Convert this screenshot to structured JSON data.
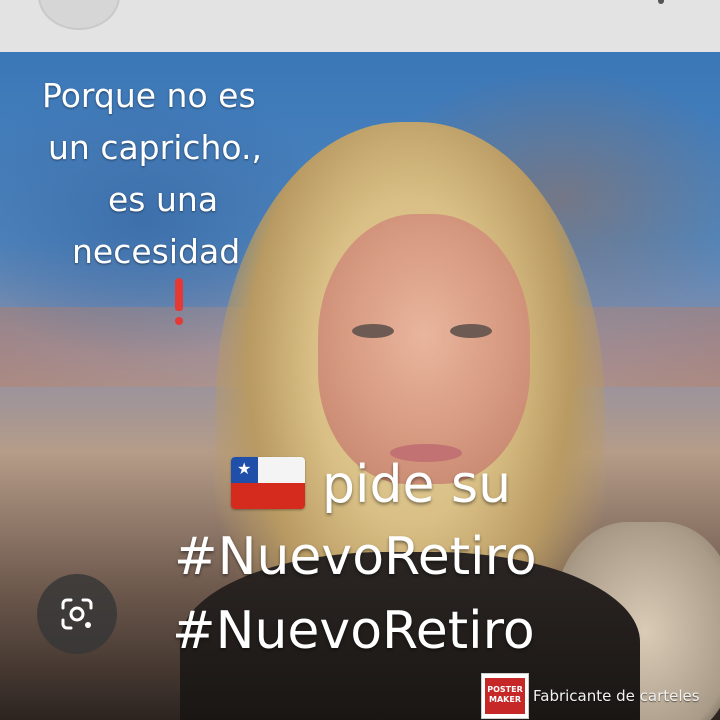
{
  "quote": {
    "lines": [
      "Porque no es",
      "un capricho.,",
      "es una",
      "necesidad"
    ]
  },
  "headline": {
    "line1": "pide su",
    "line2": "#NuevoRetiro",
    "line3": "#NuevoRetiro",
    "flag_icon": "chile-flag-icon"
  },
  "watermark": {
    "badge_text": "POSTER MAKER",
    "caption": "Fabricante de carteles"
  },
  "icons": {
    "lens": "google-lens-icon",
    "exclamation": "red-exclamation-icon"
  },
  "colors": {
    "text": "#ffffff",
    "exclamation": "#e53935",
    "badge": "#c62828"
  }
}
